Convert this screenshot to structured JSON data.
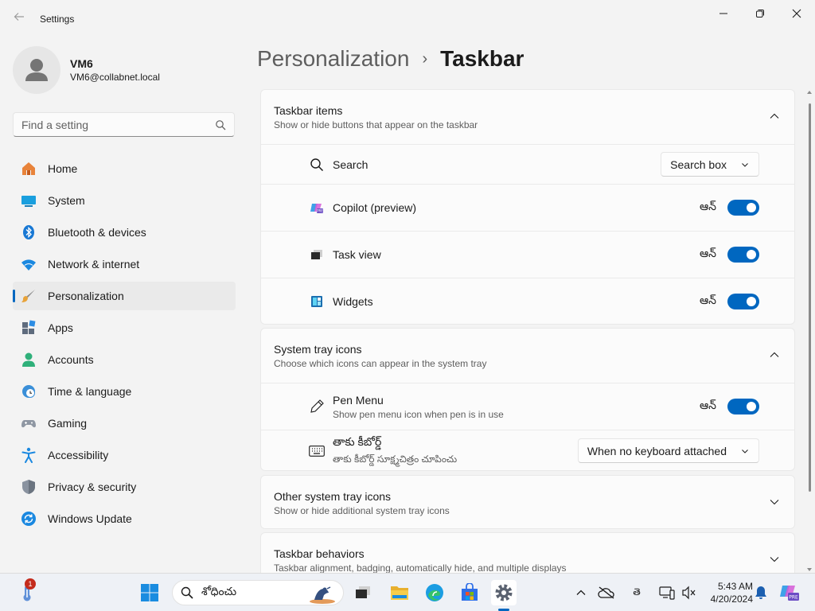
{
  "window": {
    "title": "Settings"
  },
  "profile": {
    "name": "VM6",
    "email": "VM6@collabnet.local"
  },
  "search": {
    "placeholder": "Find a setting"
  },
  "nav": {
    "items": [
      {
        "label": "Home",
        "icon": "home-icon"
      },
      {
        "label": "System",
        "icon": "monitor-icon"
      },
      {
        "label": "Bluetooth & devices",
        "icon": "bluetooth-icon"
      },
      {
        "label": "Network & internet",
        "icon": "wifi-icon"
      },
      {
        "label": "Personalization",
        "icon": "brush-icon",
        "active": true
      },
      {
        "label": "Apps",
        "icon": "apps-icon"
      },
      {
        "label": "Accounts",
        "icon": "person-icon"
      },
      {
        "label": "Time & language",
        "icon": "clock-globe-icon"
      },
      {
        "label": "Gaming",
        "icon": "gamepad-icon"
      },
      {
        "label": "Accessibility",
        "icon": "accessibility-icon"
      },
      {
        "label": "Privacy & security",
        "icon": "shield-icon"
      },
      {
        "label": "Windows Update",
        "icon": "update-icon"
      }
    ]
  },
  "breadcrumb": {
    "parent": "Personalization",
    "separator": "›",
    "current": "Taskbar"
  },
  "taskbar_items": {
    "title": "Taskbar items",
    "subtitle": "Show or hide buttons that appear on the taskbar",
    "search": {
      "label": "Search",
      "value": "Search box"
    },
    "copilot": {
      "label": "Copilot (preview)",
      "state": "ఆన్"
    },
    "task_view": {
      "label": "Task view",
      "state": "ఆన్"
    },
    "widgets": {
      "label": "Widgets",
      "state": "ఆన్"
    }
  },
  "system_tray": {
    "title": "System tray icons",
    "subtitle": "Choose which icons can appear in the system tray",
    "pen_menu": {
      "label": "Pen Menu",
      "sub": "Show pen menu icon when pen is in use",
      "state": "ఆన్"
    },
    "touch_keyboard": {
      "label": "తాకు కీబోర్డ్",
      "sub": "తాకు కీబోర్డ్ సూక్ష్మచిత్రం చూపించు",
      "value": "When no keyboard attached"
    }
  },
  "other_tray": {
    "title": "Other system tray icons",
    "subtitle": "Show or hide additional system tray icons"
  },
  "behaviors": {
    "title": "Taskbar behaviors",
    "subtitle": "Taskbar alignment, badging, automatically hide, and multiple displays"
  },
  "taskbar": {
    "search_text": "శోధించు",
    "weather_badge": "1",
    "time": "5:43 AM",
    "date": "4/20/2024",
    "lang": "తె"
  },
  "colors": {
    "accent": "#0067c0",
    "background": "#f3f3f3",
    "card": "#fbfbfb"
  }
}
